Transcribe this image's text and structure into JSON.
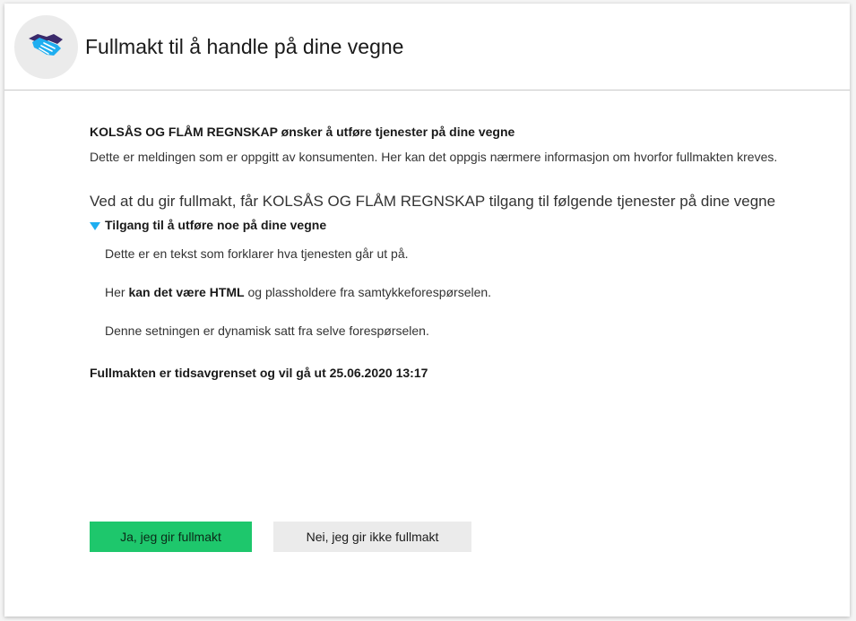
{
  "header": {
    "icon": "handshake-icon",
    "title": "Fullmakt til å handle på dine vegne"
  },
  "request": {
    "requester_line": "KOLSÅS OG FLÅM REGNSKAP ønsker å utføre tjenester på dine vegne",
    "message": "Dette er meldingen som er oppgitt av konsumenten. Her kan det oppgis nærmere informasjon om hvorfor fullmakten kreves.",
    "grant_text": "Ved at du gir fullmakt, får KOLSÅS OG FLÅM REGNSKAP tilgang til følgende tjenester på dine vegne"
  },
  "service": {
    "title": "Tilgang til å utføre noe på dine vegne",
    "expanded": true,
    "line1": "Dette er en tekst som forklarer hva tjenesten går ut på.",
    "line2_pre": "Her ",
    "line2_bold": "kan det være HTML",
    "line2_post": " og plassholdere fra samtykkeforespørselen.",
    "line3": "Denne setningen er dynamisk satt fra selve forespørselen."
  },
  "expiry": "Fullmakten er tidsavgrenset og vil gå ut 25.06.2020 13:17",
  "buttons": {
    "accept": "Ja, jeg gir fullmakt",
    "reject": "Nei, jeg gir ikke fullmakt"
  },
  "colors": {
    "accent_blue": "#1eaef0",
    "accept_green": "#1ec76c",
    "reject_gray": "#ebebeb",
    "icon_dark": "#3b2a6b"
  }
}
